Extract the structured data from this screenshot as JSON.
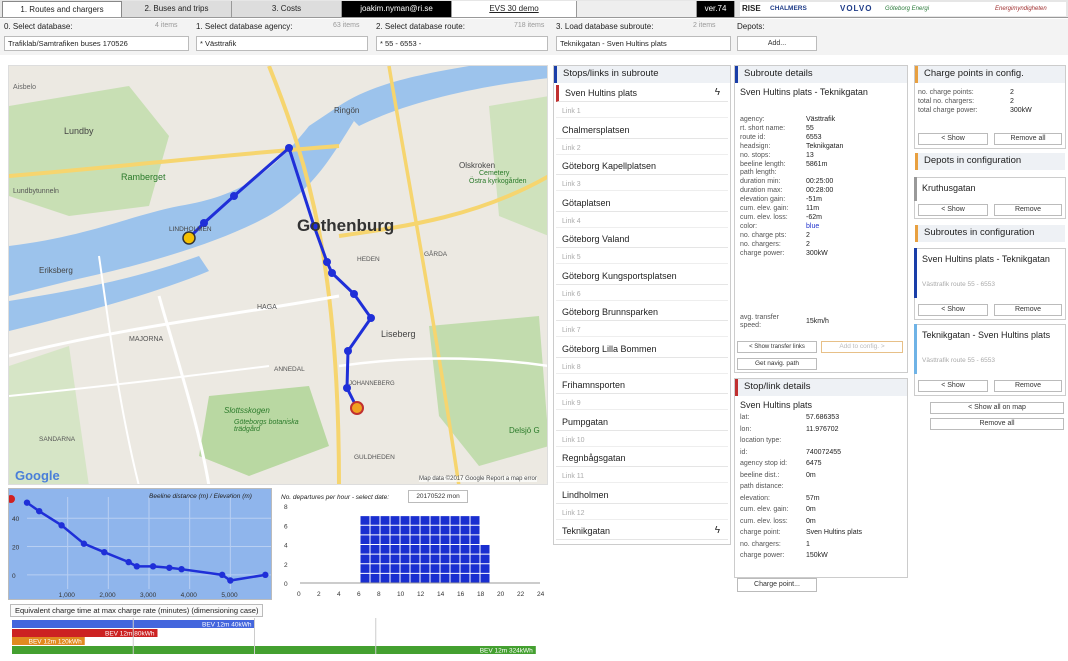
{
  "tabs": [
    "1. Routes and chargers",
    "2. Buses and trips",
    "3. Costs"
  ],
  "user_email": "joakim.nyman@ri.se",
  "demo_label": "EVS 30 demo",
  "version": "ver.74",
  "logos": [
    "RISE",
    "CHALMERS",
    "VOLVO",
    "Göteborg Energi",
    "Energimyndigheten"
  ],
  "selectors": {
    "database": {
      "label": "0. Select database:",
      "count": "4 items",
      "value": "Trafiklab/Samtrafiken buses 170526"
    },
    "agency": {
      "label": "1. Select database agency:",
      "count": "63 items",
      "value": "* Västtrafik"
    },
    "route": {
      "label": "2. Select database route:",
      "count": "718 items",
      "value": "* 55 - 6553 -"
    },
    "subroute": {
      "label": "3. Load database subroute:",
      "count": "2 items",
      "value": "Teknikgatan - Sven Hultins plats"
    },
    "depots": {
      "label": "Depots:",
      "add": "Add..."
    }
  },
  "map": {
    "labels": [
      "Ringön",
      "Lundby",
      "Ramberget",
      "Lundbytunneln",
      "Eriksberg",
      "LINDHOLMEN",
      "Gothenburg",
      "Olskroken",
      "Östra kyrkogården",
      "Cemetery",
      "GÅRDA",
      "HEDEN",
      "MAJORNA",
      "HAGA",
      "Liseberg",
      "ANNEDAL",
      "JOHANNEBERG",
      "Slottsskogen",
      "Göteborgs botaniska trädgård",
      "SANDARNA",
      "GULDHEDEN",
      "Delsjö G",
      "Aisbelo"
    ],
    "google": "Google",
    "attribution": "Map data ©2017 Google   Report a map error"
  },
  "elevation": {
    "title": "Beeline distance (m) / Elevation (m)",
    "yticks": [
      "40",
      "20",
      "0"
    ],
    "xticks": [
      "1,000",
      "2,000",
      "3,000",
      "4,000",
      "5,000"
    ]
  },
  "departures": {
    "title": "No. departures per hour - select date:",
    "date": "20170522 mon",
    "yticks": [
      "8",
      "6",
      "4",
      "2",
      "0"
    ],
    "xticks": [
      "0",
      "2",
      "4",
      "6",
      "8",
      "10",
      "12",
      "14",
      "16",
      "18",
      "20",
      "22",
      "24"
    ]
  },
  "chart_data": [
    {
      "type": "line",
      "title": "Beeline distance (m) / Elevation (m)",
      "x": [
        0,
        300,
        850,
        1400,
        1900,
        2500,
        2700,
        3100,
        3500,
        3800,
        4800,
        5000,
        5861
      ],
      "y": [
        51,
        45,
        35,
        22,
        16,
        9,
        6,
        6,
        5,
        4,
        0,
        -4,
        0
      ],
      "xlim": [
        0,
        6000
      ],
      "ylim": [
        -10,
        55
      ]
    },
    {
      "type": "bar",
      "title": "No. departures per hour - select date:",
      "categories": [
        "6",
        "7",
        "8",
        "9",
        "10",
        "11",
        "12",
        "13",
        "14",
        "15",
        "16",
        "17",
        "18"
      ],
      "values": [
        7,
        7,
        7,
        7,
        7,
        7,
        7,
        7,
        7,
        7,
        7,
        7,
        4
      ],
      "ylim": [
        0,
        8
      ]
    },
    {
      "type": "bar",
      "title": "Equivalent charge time at max charge rate (minutes) (dimensioning case)",
      "series": [
        {
          "name": "BEV 12m 40kWh",
          "value": 5.0,
          "color": "#4466dd"
        },
        {
          "name": "BEV 12m 80kWh",
          "value": 3.0,
          "color": "#cc2222"
        },
        {
          "name": "BEV 12m 120kWh",
          "value": 1.5,
          "color": "#e08a20"
        },
        {
          "name": "BEV 12m 324kWh",
          "value": 10.8,
          "color": "#44a030"
        }
      ],
      "xticks": [
        "2.5",
        "5.0",
        "7.5"
      ]
    }
  ],
  "charge_chart_title": "Equivalent charge time at max charge rate (minutes) (dimensioning case)",
  "stops_panel": {
    "header": "Stops/links in subroute",
    "stops": [
      "Sven Hultins plats",
      "Chalmersplatsen",
      "Göteborg Kapellplatsen",
      "Götaplatsen",
      "Göteborg Valand",
      "Göteborg Kungsportsplatsen",
      "Göteborg Brunnsparken",
      "Göteborg Lilla Bommen",
      "Frihamnsporten",
      "Pumpgatan",
      "Regnbågsgatan",
      "Lindholmen",
      "Teknikgatan"
    ],
    "links": [
      "Link 1",
      "Link 2",
      "Link 3",
      "Link 4",
      "Link 5",
      "Link 6",
      "Link 7",
      "Link 8",
      "Link 9",
      "Link 10",
      "Link 11",
      "Link 12"
    ]
  },
  "subroute_details": {
    "header": "Subroute details",
    "name": "Sven Hultins plats - Teknikgatan",
    "fields": [
      [
        "agency:",
        "Västtrafik"
      ],
      [
        "rt. short name:",
        "55"
      ],
      [
        "route id:",
        "6553"
      ],
      [
        "headsign:",
        "Teknikgatan"
      ],
      [
        "no. stops:",
        "13"
      ],
      [
        "beeline length:",
        "5861m"
      ],
      [
        "path length:",
        ""
      ],
      [
        "duration min:",
        "00:25:00"
      ],
      [
        "duration max:",
        "00:28:00"
      ],
      [
        "elevation gain:",
        "-51m"
      ],
      [
        "cum. elev. gain:",
        "11m"
      ],
      [
        "cum. elev. loss:",
        "-62m"
      ],
      [
        "color:",
        "blue"
      ],
      [
        "no. charge pts:",
        "2"
      ],
      [
        "no. chargers:",
        "2"
      ],
      [
        "charge power:",
        "300kW"
      ],
      [
        "avg. transfer speed:",
        "15km/h"
      ]
    ],
    "btn_transfer": "< Show transfer links",
    "btn_add": "Add to config. >",
    "btn_navig": "Get navig. path"
  },
  "stop_details": {
    "header": "Stop/link details",
    "name": "Sven Hultins plats",
    "fields": [
      [
        "lat:",
        "57.686353"
      ],
      [
        "lon:",
        "11.976702"
      ],
      [
        "location type:",
        ""
      ],
      [
        "id:",
        "740072455"
      ],
      [
        "agency stop id:",
        "6475"
      ],
      [
        "beeline dist.:",
        "0m"
      ],
      [
        "path distance:",
        ""
      ],
      [
        "elevation:",
        "57m"
      ],
      [
        "cum. elev. gain:",
        "0m"
      ],
      [
        "cum. elev. loss:",
        "0m"
      ],
      [
        "charge point:",
        "Sven Hultins plats"
      ],
      [
        "no. chargers:",
        "1"
      ],
      [
        "charge power:",
        "150kW"
      ]
    ],
    "btn_charge": "Charge point..."
  },
  "charge_points": {
    "header": "Charge points in config.",
    "fields": [
      [
        "no. charge points:",
        "2"
      ],
      [
        "total no. chargers:",
        "2"
      ],
      [
        "total charge power:",
        "300kW"
      ]
    ],
    "btn_show": "< Show",
    "btn_remove_all": "Remove all"
  },
  "depots": {
    "header": "Depots in configuration",
    "items": [
      "Kruthusgatan"
    ],
    "btn_show": "< Show",
    "btn_remove": "Remove"
  },
  "subroutes_cfg": {
    "header": "Subroutes in configuration",
    "items": [
      {
        "title": "Sven Hultins plats - Teknikgatan",
        "sub": "Västtrafik route 55 - 6553",
        "color": "#1a3ea8"
      },
      {
        "title": "Teknikgatan - Sven Hultins plats",
        "sub": "Västtrafik route 55 - 6553",
        "color": "#6fb3e6"
      }
    ],
    "btn_show": "< Show",
    "btn_remove": "Remove",
    "btn_show_all": "< Show all on map",
    "btn_remove_all": "Remove all"
  }
}
